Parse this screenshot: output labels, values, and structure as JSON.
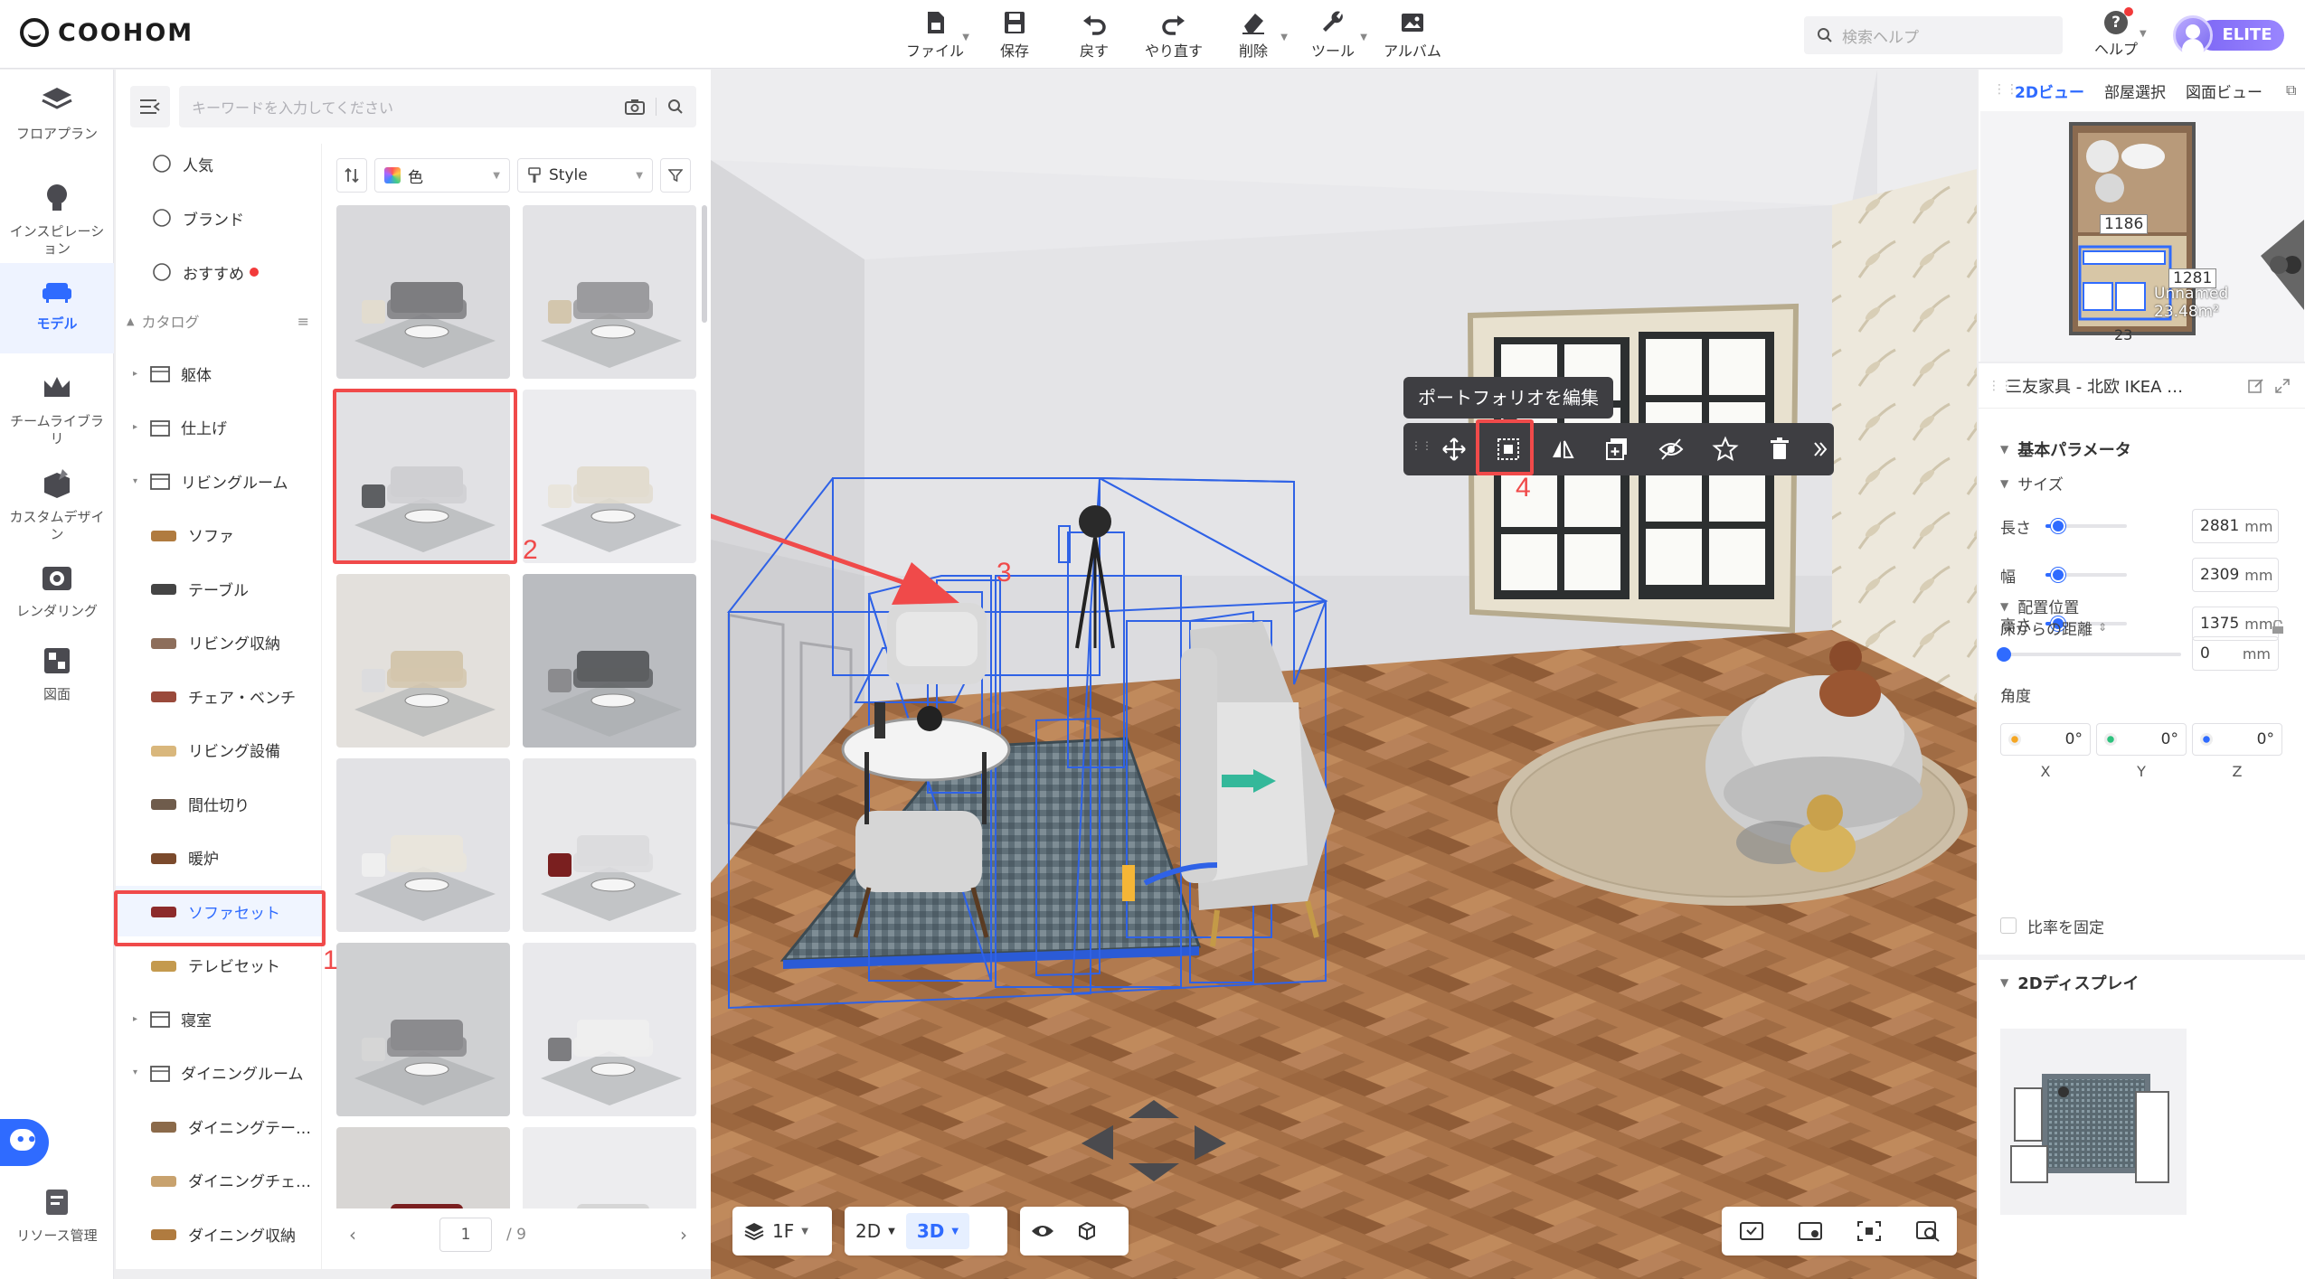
{
  "app": {
    "logo_text": "COOHOM"
  },
  "toolbar": {
    "items": [
      {
        "label": "ファイル",
        "icon": "file-icon",
        "caret": true
      },
      {
        "label": "保存",
        "icon": "save-icon",
        "caret": false
      },
      {
        "label": "戻す",
        "icon": "undo-icon",
        "caret": false
      },
      {
        "label": "やり直す",
        "icon": "redo-icon",
        "caret": false
      },
      {
        "label": "削除",
        "icon": "eraser-icon",
        "caret": true
      },
      {
        "label": "ツール",
        "icon": "wrench-icon",
        "caret": true
      },
      {
        "label": "アルバム",
        "icon": "album-icon",
        "caret": false
      }
    ],
    "search_placeholder": "検索ヘルプ",
    "help_label": "ヘルプ",
    "badge": "ELITE"
  },
  "rail": {
    "items": [
      {
        "label": "フロアプラン",
        "icon": "floorplan-icon",
        "active": false
      },
      {
        "label": "インスピレーション",
        "icon": "lightbulb-icon",
        "active": false
      },
      {
        "label": "モデル",
        "icon": "sofa-icon",
        "active": true
      },
      {
        "label": "チームライブラリ",
        "icon": "crown-icon",
        "active": false
      },
      {
        "label": "カスタムデザイン",
        "icon": "custom-box-icon",
        "active": false
      },
      {
        "label": "レンダリング",
        "icon": "camera-icon",
        "active": false
      },
      {
        "label": "図面",
        "icon": "drawing-icon",
        "active": false
      }
    ],
    "bottom_label": "リソース管理"
  },
  "library": {
    "search_placeholder": "キーワードを入力してください",
    "top_categories": [
      "人気",
      "ブランド",
      "おすすめ"
    ],
    "catalog_label": "カタログ",
    "categories": [
      {
        "label": "躯体",
        "level": 0,
        "arrow": "▸"
      },
      {
        "label": "仕上げ",
        "level": 0,
        "arrow": "▸"
      },
      {
        "label": "リビングルーム",
        "level": 0,
        "arrow": "▾"
      },
      {
        "label": "ソファ",
        "level": 1
      },
      {
        "label": "テーブル",
        "level": 1
      },
      {
        "label": "リビング収納",
        "level": 1
      },
      {
        "label": "チェア・ベンチ",
        "level": 1
      },
      {
        "label": "リビング設備",
        "level": 1
      },
      {
        "label": "間仕切り",
        "level": 1
      },
      {
        "label": "暖炉",
        "level": 1
      },
      {
        "label": "ソファセット",
        "level": 1,
        "selected": true
      },
      {
        "label": "テレビセット",
        "level": 1
      },
      {
        "label": "寝室",
        "level": 0,
        "arrow": "▸"
      },
      {
        "label": "ダイニングルーム",
        "level": 0,
        "arrow": "▾"
      },
      {
        "label": "ダイニングテー…",
        "level": 1
      },
      {
        "label": "ダイニングチェ…",
        "level": 1
      },
      {
        "label": "ダイニング収納",
        "level": 1
      }
    ],
    "filter_color": "色",
    "filter_style": "Style",
    "page_current": "1",
    "page_total": "/ 9"
  },
  "annotations": {
    "a1": "1",
    "a2": "2",
    "a3": "3",
    "a4": "4"
  },
  "viewport": {
    "tooltip": "ポートフォリオを編集",
    "floor_label": "1F",
    "view_2d": "2D",
    "view_3d": "3D",
    "floatbar_icons": [
      "move-icon",
      "edit-group-icon",
      "mirror-icon",
      "duplicate-icon",
      "hide-icon",
      "favorite-icon",
      "delete-icon",
      "expand-icon"
    ]
  },
  "minimap": {
    "tabs": [
      "2Dビュー",
      "部屋選択",
      "図面ビュー"
    ],
    "labels": {
      "width": "1186",
      "depth": "1281",
      "room_name": "Unnamed",
      "area": "23.48m²",
      "bottom": "23"
    }
  },
  "properties": {
    "title": "三友家具 - 北欧 IKEA …",
    "section_basic": "基本パラメータ",
    "section_size": "サイズ",
    "size": [
      {
        "label": "長さ",
        "value": "2881",
        "unit": "mm",
        "level": 0.15
      },
      {
        "label": "幅",
        "value": "2309",
        "unit": "mm",
        "level": 0.15
      },
      {
        "label": "高さ",
        "value": "1375",
        "unit": "mm",
        "level": 0.15
      }
    ],
    "section_position": "配置位置",
    "floor_distance_label": "床からの距離",
    "floor_distance_value": "0",
    "floor_distance_unit": "mm",
    "angle_label": "角度",
    "angles": [
      {
        "axis": "X",
        "value": "0°",
        "color": "#f5a623"
      },
      {
        "axis": "Y",
        "value": "0°",
        "color": "#2ec27e"
      },
      {
        "axis": "Z",
        "value": "0°",
        "color": "#2f6bff"
      }
    ],
    "lock_ratio": "比率を固定",
    "section_2d": "2Dディスプレイ"
  }
}
